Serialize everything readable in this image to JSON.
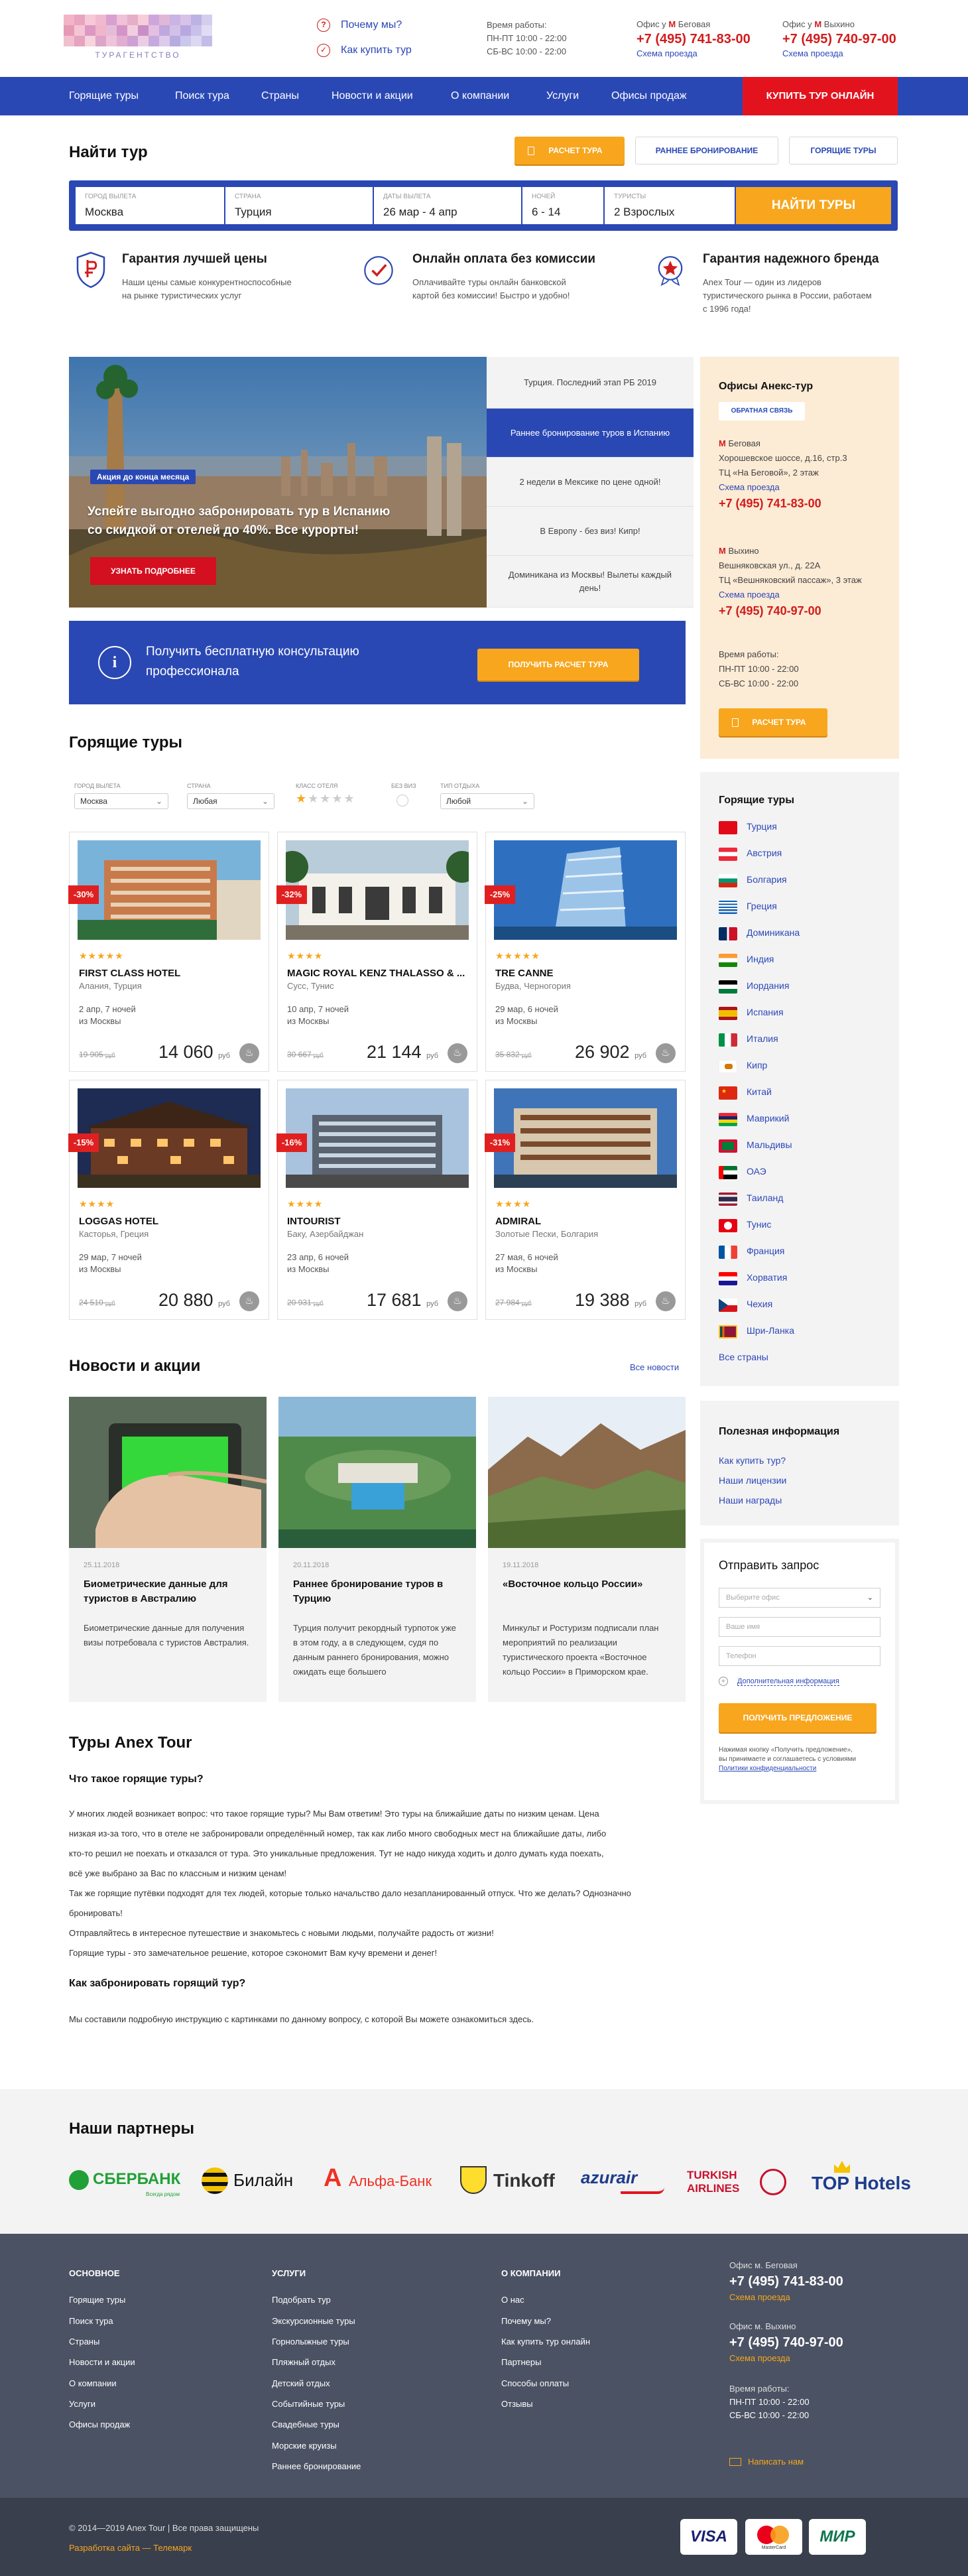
{
  "header": {
    "logo_text": "ТУРАГЕНТСТВО",
    "why_us": "Почему мы?",
    "how_to_buy": "Как купить тур",
    "hours_title": "Время работы:",
    "hours_weekday": "ПН-ПТ 10:00 - 22:00",
    "hours_weekend": "СБ-ВС 10:00 - 22:00",
    "office1_label": "Офис у",
    "office1_metro": "Беговая",
    "office1_phone": "+7 (495) 741-83-00",
    "office1_map": "Схема проезда",
    "office2_label": "Офис у",
    "office2_metro": "Выхино",
    "office2_phone": "+7 (495) 740-97-00",
    "office2_map": "Схема проезда"
  },
  "nav": {
    "items": [
      "Горящие туры",
      "Поиск тура",
      "Страны",
      "Новости и акции",
      "О компании",
      "Услуги",
      "Офисы продаж"
    ],
    "cta": "КУПИТЬ ТУР ОНЛАЙН"
  },
  "search": {
    "title": "Найти тур",
    "tabs": [
      "РАСЧЕТ ТУРА",
      "РАННЕЕ БРОНИРОВАНИЕ",
      "ГОРЯЩИЕ ТУРЫ"
    ],
    "fields": [
      {
        "label": "ГОРОД ВЫЛЕТА",
        "value": "Москва"
      },
      {
        "label": "СТРАНА",
        "value": "Турция"
      },
      {
        "label": "ДАТЫ ВЫЛЕТА",
        "value": "26 мар - 4 апр"
      },
      {
        "label": "НОЧЕЙ",
        "value": "6 - 14"
      },
      {
        "label": "ТУРИСТЫ",
        "value": "2 Взрослых"
      }
    ],
    "button": "НАЙТИ ТУРЫ"
  },
  "features": [
    {
      "icon": "ruble-shield-icon",
      "title": "Гарантия лучшей цены",
      "text1": "Наши цены самые конкурентноспособные",
      "text2": "на рынке туристических услуг"
    },
    {
      "icon": "checkmark-circle-icon",
      "title": "Онлайн оплата без комиссии",
      "text1": "Оплачивайте туры онлайн банковской",
      "text2": "картой без комиссии! Быстро и удобно!"
    },
    {
      "icon": "star-badge-icon",
      "title": "Гарантия надежного бренда",
      "text1": "Anex Tour — один из лидеров",
      "text2": "туристического рынка в России, работаем",
      "text3": "с 1996 года!"
    }
  ],
  "promo": {
    "badge": "Акция до конца месяца",
    "text1": "Успейте выгодно забронировать тур в Испанию",
    "text2": "со скидкой от отелей до 40%. Все курорты!",
    "button": "УЗНАТЬ ПОДРОБНЕЕ",
    "slides": [
      "Турция. Последний этап РБ 2019",
      "Раннее бронирование туров в Испанию",
      "2 недели в Мексике по цене одной!",
      "В Европу - без виз! Кипр!",
      "Доминикана из Москвы! Вылеты каждый день!"
    ]
  },
  "consult": {
    "text1": "Получить бесплатную консультацию",
    "text2": "профессионала",
    "button": "ПОЛУЧИТЬ РАСЧЕТ ТУРА"
  },
  "hot": {
    "title": "Горящие туры",
    "filters": [
      {
        "label": "ГОРОД ВЫЛЕТА",
        "value": "Москва"
      },
      {
        "label": "СТРАНА",
        "value": "Любая"
      },
      {
        "label": "КЛАСС ОТЕЛЯ",
        "value": ""
      },
      {
        "label": "БЕЗ ВИЗ",
        "value": ""
      },
      {
        "label": "ТИП ОТДЫХА",
        "value": "Любой"
      }
    ],
    "cards": [
      {
        "discount": "-30%",
        "stars": "★★★★★",
        "name": "FIRST CLASS HOTEL",
        "location": "Алания, Турция",
        "dates": "2 апр, 7 ночей",
        "from": "из Москвы",
        "old": "19 905",
        "price": "14 060",
        "currency": "руб"
      },
      {
        "discount": "-32%",
        "stars": "★★★★",
        "name": "MAGIC ROYAL KENZ THALASSO & ...",
        "location": "Сусс, Тунис",
        "dates": "10 апр, 7 ночей",
        "from": "из Москвы",
        "old": "30 667",
        "price": "21 144",
        "currency": "руб"
      },
      {
        "discount": "-25%",
        "stars": "★★★★★",
        "name": "TRE CANNE",
        "location": "Будва, Черногория",
        "dates": "29 мар, 6 ночей",
        "from": "из Москвы",
        "old": "35 832",
        "price": "26 902",
        "currency": "руб"
      },
      {
        "discount": "-15%",
        "stars": "★★★★",
        "name": "LOGGAS HOTEL",
        "location": "Касторья, Греция",
        "dates": "29 мар, 7 ночей",
        "from": "из Москвы",
        "old": "24 510",
        "price": "20 880",
        "currency": "руб"
      },
      {
        "discount": "-16%",
        "stars": "★★★★",
        "name": "INTOURIST",
        "location": "Баку, Азербайджан",
        "dates": "23 апр, 6 ночей",
        "from": "из Москвы",
        "old": "20 931",
        "price": "17 681",
        "currency": "руб"
      },
      {
        "discount": "-31%",
        "stars": "★★★★",
        "name": "ADMIRAL",
        "location": "Золотые Пески, Болгария",
        "dates": "27 мая, 6 ночей",
        "from": "из Москвы",
        "old": "27 984",
        "price": "19 388",
        "currency": "руб"
      }
    ]
  },
  "news": {
    "title": "Новости и акции",
    "all": "Все новости",
    "items": [
      {
        "date": "25.11.2018",
        "title": "Биометрические данные для туристов в Австралию",
        "text": "Биометрические данные для получения визы потребовала с туристов Австралия."
      },
      {
        "date": "20.11.2018",
        "title": "Раннее бронирование туров в Турцию",
        "text": "Турция получит рекордный турпоток уже в этом году, а в следующем, судя по данным раннего бронирования, можно ожидать еще большего"
      },
      {
        "date": "19.11.2018",
        "title": "«Восточное кольцо России»",
        "text": "Минкульт и Ростуризм подписали план мероприятий по реализации туристического проекта «Восточное кольцо России» в Приморском крае."
      }
    ]
  },
  "article": {
    "title": "Туры Anex Tour",
    "q1": "Что такое горящие туры?",
    "p1": [
      "У многих людей возникает вопрос: что такое горящие туры? Мы Вам ответим! Это туры на ближайшие даты по низким ценам. Цена",
      "низкая из-за того, что в отеле не забронировали определённый номер, так как либо много свободных мест на ближайшие даты, либо",
      "кто-то решил не поехать и отказался от тура. Это уникальные предложения. Тут не надо никуда ходить и долго думать куда поехать,",
      "всё уже выбрано за Вас по классным и низким ценам!",
      "Так же горящие путёвки подходят для тех людей, которые только начальство дало незапланированный отпуск. Что же делать? Однозначно",
      "бронировать!",
      "Отправляйтесь в интересное путешествие и знакомьтесь с новыми людьми, получайте радость от жизни!",
      "Горящие туры - это замечательное решение, которое сэкономит Вам кучу времени и денег!"
    ],
    "q2": "Как забронировать горящий тур?",
    "p2": "Мы составили подробную инструкцию с картинками по данному вопросу, с которой Вы можете ознакомиться здесь."
  },
  "partners": {
    "title": "Наши партнеры",
    "items": [
      "СБЕРБАНК",
      "Билайн",
      "Альфа-Банк",
      "Tinkoff",
      "azurair",
      "TURKISH AIRLINES",
      "TOP Hotels"
    ],
    "sber_sub": "Всегда рядом"
  },
  "sidebar": {
    "offices_title": "Офисы Анекс-тур",
    "feedback": "ОБРАТНАЯ СВЯЗЬ",
    "o1_metro": "Беговая",
    "o1_addr1": "Хорошевское шоссе, д.16, стр.3",
    "o1_addr2": "ТЦ «На Беговой», 2 этаж",
    "o1_map": "Схема проезда",
    "o1_phone": "+7 (495) 741-83-00",
    "o2_metro": "Выхино",
    "o2_addr1": "Вешняковская ул., д. 22А",
    "o2_addr2": "ТЦ «Вешняковский пассаж», 3 этаж",
    "o2_map": "Схема проезда",
    "o2_phone": "+7 (495) 740-97-00",
    "hours_title": "Время работы:",
    "hours_weekday": "ПН-ПТ 10:00 - 22:00",
    "hours_weekend": "СБ-ВС 10:00 - 22:00",
    "calc": "РАСЧЕТ ТУРА",
    "hot_title": "Горящие туры",
    "countries": [
      "Турция",
      "Австрия",
      "Болгария",
      "Греция",
      "Доминикана",
      "Индия",
      "Иордания",
      "Испания",
      "Италия",
      "Кипр",
      "Китай",
      "Маврикий",
      "Мальдивы",
      "ОАЭ",
      "Таиланд",
      "Тунис",
      "Франция",
      "Хорватия",
      "Чехия",
      "Шри-Ланка"
    ],
    "all_countries": "Все страны",
    "useful_title": "Полезная информация",
    "useful": [
      "Как купить тур?",
      "Наши лицензии",
      "Наши награды"
    ],
    "form_title": "Отправить запрос",
    "form_office": "Выберите офис",
    "form_name": "Ваше имя",
    "form_phone": "Телефон",
    "form_more": "Дополнительная информация",
    "form_button": "ПОЛУЧИТЬ ПРЕДЛОЖЕНИЕ",
    "form_note1": "Нажимая кнопку «Получить предложение»,",
    "form_note2": "вы принимаете и соглашаетесь с условиями",
    "form_note3": "Политики конфиденциальности"
  },
  "footer": {
    "col1_title": "Основное",
    "col1": [
      "Горящие туры",
      "Поиск тура",
      "Страны",
      "Новости и акции",
      "О компании",
      "Услуги",
      "Офисы продаж"
    ],
    "col2_title": "Услуги",
    "col2": [
      "Подобрать тур",
      "Экскурсионные туры",
      "Горнолыжные туры",
      "Пляжный отдых",
      "Детский отдых",
      "Событийные туры",
      "Свадебные туры",
      "Морские круизы",
      "Раннее бронирование"
    ],
    "col3_title": "О компании",
    "col3": [
      "О нас",
      "Почему мы?",
      "Как купить тур онлайн",
      "Партнеры",
      "Способы оплаты",
      "Отзывы"
    ],
    "o1": "Офис м. Беговая",
    "o1_phone": "+7 (495) 741-83-00",
    "o1_map": "Схема проезда",
    "o2": "Офис м. Выхино",
    "o2_phone": "+7 (495) 740-97-00",
    "o2_map": "Схема проезда",
    "hours_title": "Время работы:",
    "hours_weekday": "ПН-ПТ 10:00 - 22:00",
    "hours_weekend": "СБ-ВС 10:00 - 22:00",
    "write": "Написать нам",
    "copyright": "© 2014—2019 Anex Tour | Все права защищены",
    "dev": "Разработка сайта — Телемарк",
    "pay": [
      "VISA",
      "MasterCard",
      "МИР"
    ]
  }
}
